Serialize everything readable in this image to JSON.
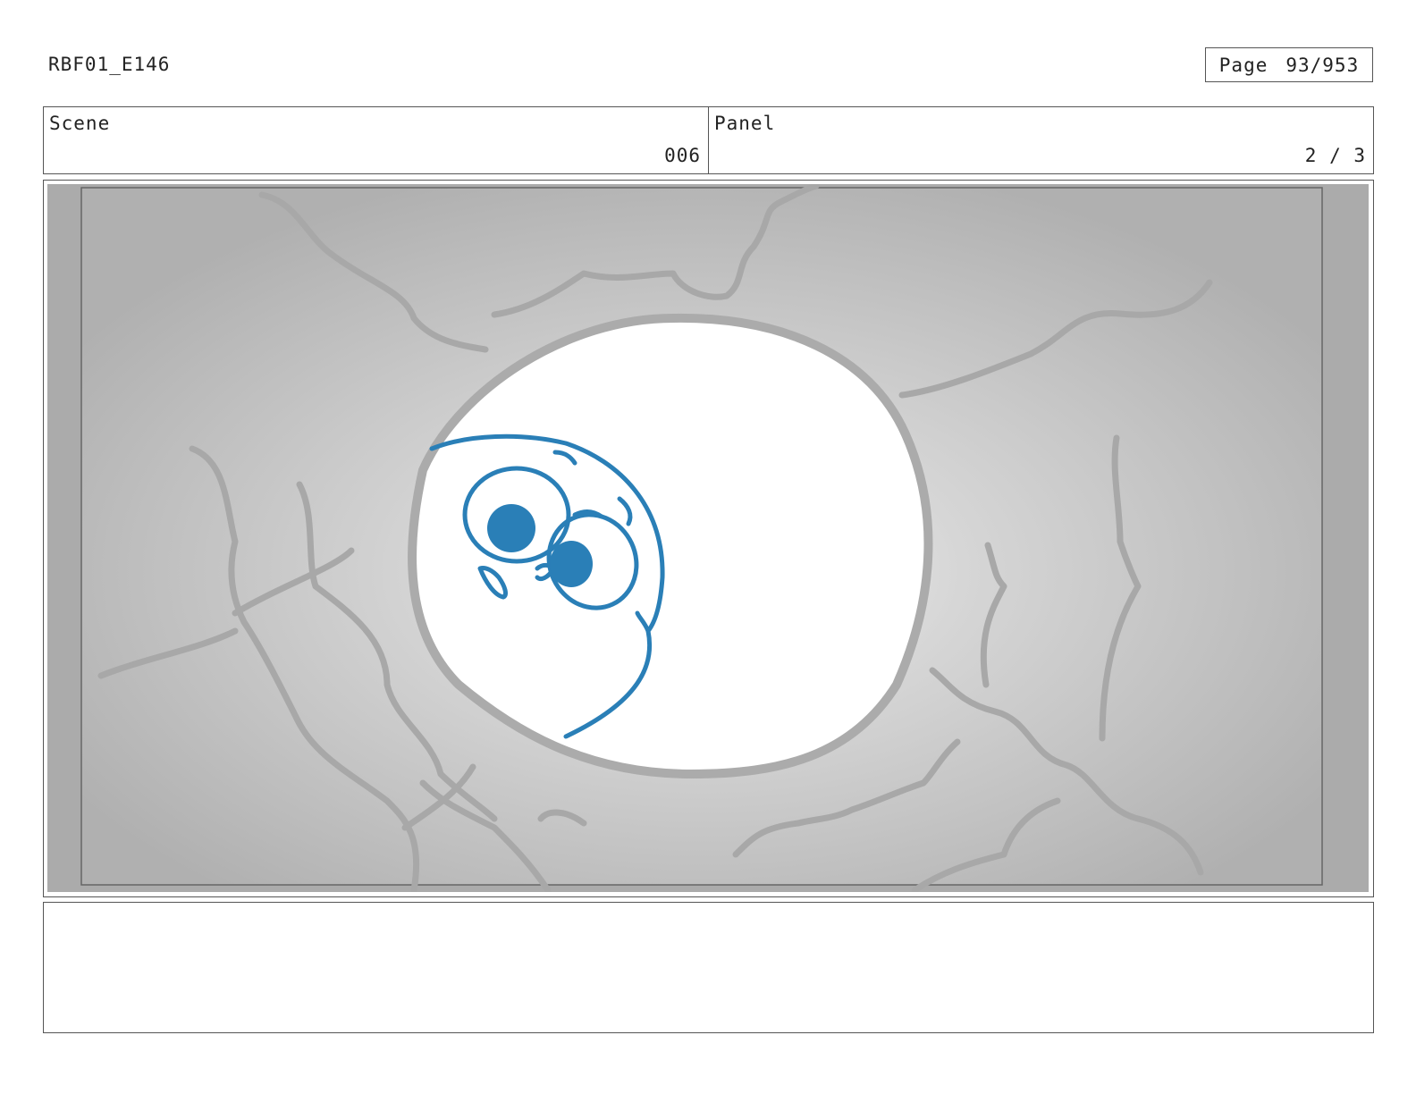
{
  "header": {
    "episode_code": "RBF01_E146",
    "page_label": "Page",
    "page_number": "93/953"
  },
  "info": {
    "scene_label": "Scene",
    "scene_value": "006",
    "panel_label": "Panel",
    "panel_value": "2 / 3"
  },
  "artwork": {
    "description_icon": "storyboard-drawing",
    "character_color": "#2a7fb7",
    "background_color": "#c9c9c9",
    "crack_color": "#a6a6a6"
  },
  "notes": {
    "text": ""
  }
}
